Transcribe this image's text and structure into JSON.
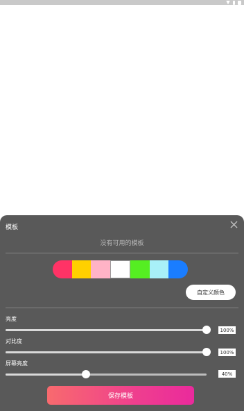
{
  "status_bar": {
    "icons": [
      "wifi-icon",
      "signal-icon",
      "battery-icon"
    ]
  },
  "panel": {
    "title": "模板",
    "close_icon": "close-icon",
    "empty_text": "没有可用的模板"
  },
  "colors": {
    "swatches": [
      "#ff3366",
      "#ffd000",
      "#ffb3c6",
      "#ffffff",
      "#55ee22",
      "#a8f0f8",
      "#1a7dff"
    ],
    "selected_index": 3,
    "custom_label": "自定义颜色"
  },
  "sliders": [
    {
      "label": "亮度",
      "value_text": "100%",
      "level": 1.0
    },
    {
      "label": "对比度",
      "value_text": "100%",
      "level": 1.0
    },
    {
      "label": "屏幕亮度",
      "value_text": "40%",
      "level": 0.4
    }
  ],
  "save_label": "保存模板",
  "accent": {
    "panel_bg": "#595959",
    "gradient_start": "#f86a6e",
    "gradient_end": "#ea2a9c"
  }
}
